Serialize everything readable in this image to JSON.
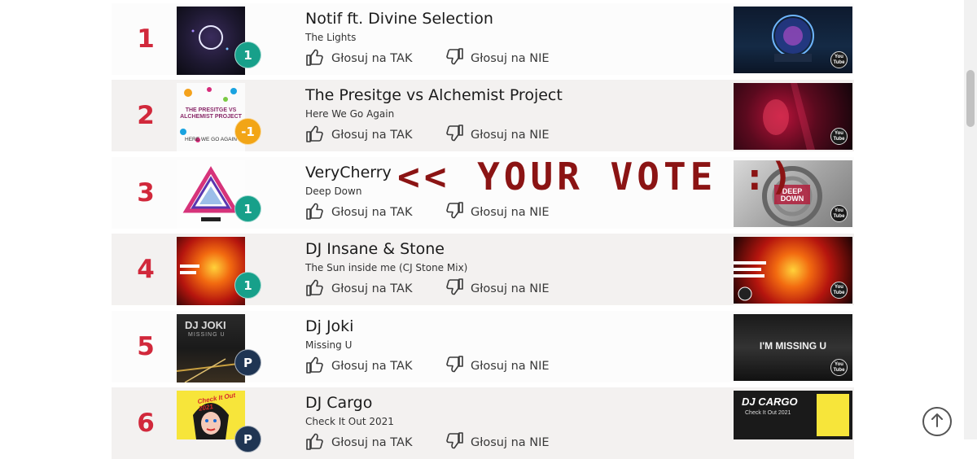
{
  "vote_yes_label": "Głosuj na TAK",
  "vote_no_label": "Głosuj na NIE",
  "overlay_text": "<< YOUR VOTE :)",
  "youtube_badge": {
    "line1": "You",
    "line2": "Tube"
  },
  "colors": {
    "rank": "#d1283b",
    "badge_green": "#17a08a",
    "badge_orange": "#f2a516",
    "badge_navy": "#1f3553",
    "overlay": "#8b1414"
  },
  "icons": [
    "thumbs-up-icon",
    "thumbs-down-icon",
    "youtube-icon",
    "arrow-up-icon"
  ],
  "entries": [
    {
      "rank": "1",
      "artist": "Notif ft. Divine Selection",
      "title": "The Lights",
      "badge": "1",
      "badge_color": "#17a08a"
    },
    {
      "rank": "2",
      "artist": "The Presitge vs Alchemist Project",
      "title": "Here We Go Again",
      "badge": "-1",
      "badge_color": "#f2a516"
    },
    {
      "rank": "3",
      "artist": "VeryCherry",
      "title": "Deep Down",
      "badge": "1",
      "badge_color": "#17a08a"
    },
    {
      "rank": "4",
      "artist": "DJ Insane & Stone",
      "title": "The Sun inside me (CJ Stone Mix)",
      "badge": "1",
      "badge_color": "#17a08a"
    },
    {
      "rank": "5",
      "artist": "Dj Joki",
      "title": "Missing U",
      "badge": "P",
      "badge_color": "#1f3553"
    },
    {
      "rank": "6",
      "artist": "DJ Cargo",
      "title": "Check It Out 2021",
      "badge": "P",
      "badge_color": "#1f3553"
    }
  ],
  "cover_text": {
    "cover2_top": "THE PRESITGE VS ALCHEMIST PROJECT",
    "cover2_bottom": "HERE WE GO AGAIN",
    "cover5_top": "DJ JOKI",
    "cover5_sub": "MISSING U",
    "cover6_top": "Check It Out 2021"
  },
  "thumb_text": {
    "thumb3": "DEEP DOWN",
    "thumb5": "I'M MISSING U",
    "thumb6_top": "DJ CARGO",
    "thumb6_sub": "Check It Out 2021"
  }
}
